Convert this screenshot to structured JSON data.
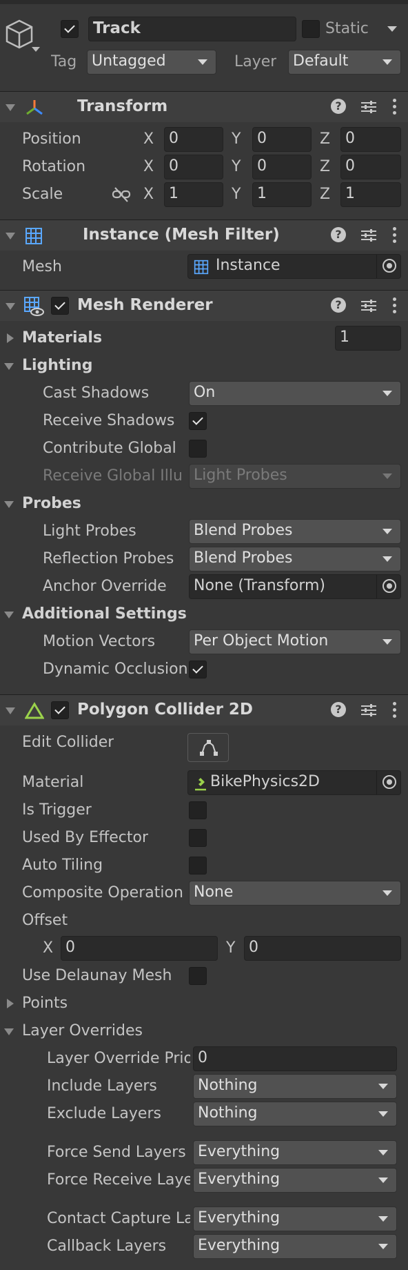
{
  "gameobject": {
    "name": "Track",
    "active": true,
    "static_label": "Static",
    "static_checked": false,
    "tag_label": "Tag",
    "tag_value": "Untagged",
    "layer_label": "Layer",
    "layer_value": "Default"
  },
  "transform": {
    "title": "Transform",
    "rows": [
      {
        "label": "Position",
        "x": "0",
        "y": "0",
        "z": "0"
      },
      {
        "label": "Rotation",
        "x": "0",
        "y": "0",
        "z": "0"
      },
      {
        "label": "Scale",
        "x": "1",
        "y": "1",
        "z": "1"
      }
    ],
    "axis_x": "X",
    "axis_y": "Y",
    "axis_z": "Z"
  },
  "mesh_filter": {
    "title": "Instance (Mesh Filter)",
    "mesh_label": "Mesh",
    "mesh_value": "Instance"
  },
  "mesh_renderer": {
    "title": "Mesh Renderer",
    "enabled": true,
    "materials_label": "Materials",
    "materials_count": "1",
    "lighting_label": "Lighting",
    "cast_shadows_label": "Cast Shadows",
    "cast_shadows_value": "On",
    "receive_shadows_label": "Receive Shadows",
    "receive_shadows_checked": true,
    "contribute_global_label": "Contribute Global",
    "contribute_global_checked": false,
    "receive_global_label": "Receive Global Illu",
    "receive_global_value": "Light Probes",
    "probes_label": "Probes",
    "light_probes_label": "Light Probes",
    "light_probes_value": "Blend Probes",
    "reflection_probes_label": "Reflection Probes",
    "reflection_probes_value": "Blend Probes",
    "anchor_override_label": "Anchor Override",
    "anchor_override_value": "None (Transform)",
    "additional_label": "Additional Settings",
    "motion_vectors_label": "Motion Vectors",
    "motion_vectors_value": "Per Object Motion",
    "dynamic_occlusion_label": "Dynamic Occlusion",
    "dynamic_occlusion_checked": true
  },
  "polygon_collider": {
    "title": "Polygon Collider 2D",
    "enabled": true,
    "edit_collider_label": "Edit Collider",
    "material_label": "Material",
    "material_value": "BikePhysics2D",
    "is_trigger_label": "Is Trigger",
    "used_by_effector_label": "Used By Effector",
    "auto_tiling_label": "Auto Tiling",
    "composite_label": "Composite Operation",
    "composite_value": "None",
    "offset_label": "Offset",
    "offset_x_label": "X",
    "offset_x": "0",
    "offset_y_label": "Y",
    "offset_y": "0",
    "delaunay_label": "Use Delaunay Mesh",
    "points_label": "Points",
    "layer_overrides_label": "Layer Overrides",
    "layer_override_priority_label": "Layer Override Priority",
    "layer_override_priority_value": "0",
    "include_layers_label": "Include Layers",
    "include_layers_value": "Nothing",
    "exclude_layers_label": "Exclude Layers",
    "exclude_layers_value": "Nothing",
    "force_send_label": "Force Send Layers",
    "force_send_value": "Everything",
    "force_receive_label": "Force Receive Layers",
    "force_receive_value": "Everything",
    "contact_capture_label": "Contact Capture Layers",
    "contact_capture_value": "Everything",
    "callback_label": "Callback Layers",
    "callback_value": "Everything"
  },
  "colors": {
    "background": "#383838",
    "header": "#3e3e3e",
    "field": "#2a2a2a",
    "dropdown": "#515151",
    "accent_green": "#9bd24b"
  }
}
